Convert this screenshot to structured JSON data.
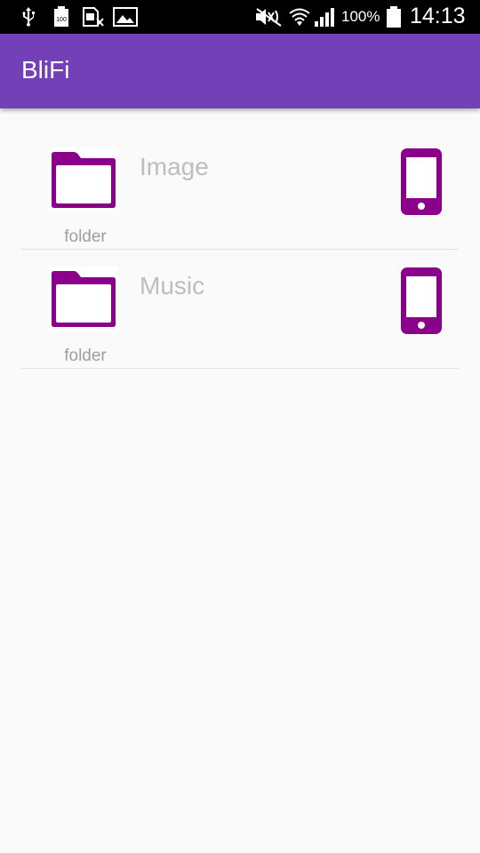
{
  "status_bar": {
    "battery_percent": "100%",
    "time": "14:13",
    "icons": [
      "usb-icon",
      "battery-full-icon",
      "sim-icon",
      "image-icon",
      "mute-icon",
      "wifi-icon",
      "signal-icon",
      "battery-icon"
    ]
  },
  "app_bar": {
    "title": "BliFi",
    "color": "#7340b7"
  },
  "accent_color": "#8a008a",
  "items": [
    {
      "name": "Image",
      "type": "folder",
      "icon": "folder-icon",
      "location_icon": "phone-icon"
    },
    {
      "name": "Music",
      "type": "folder",
      "icon": "folder-icon",
      "location_icon": "phone-icon"
    }
  ]
}
